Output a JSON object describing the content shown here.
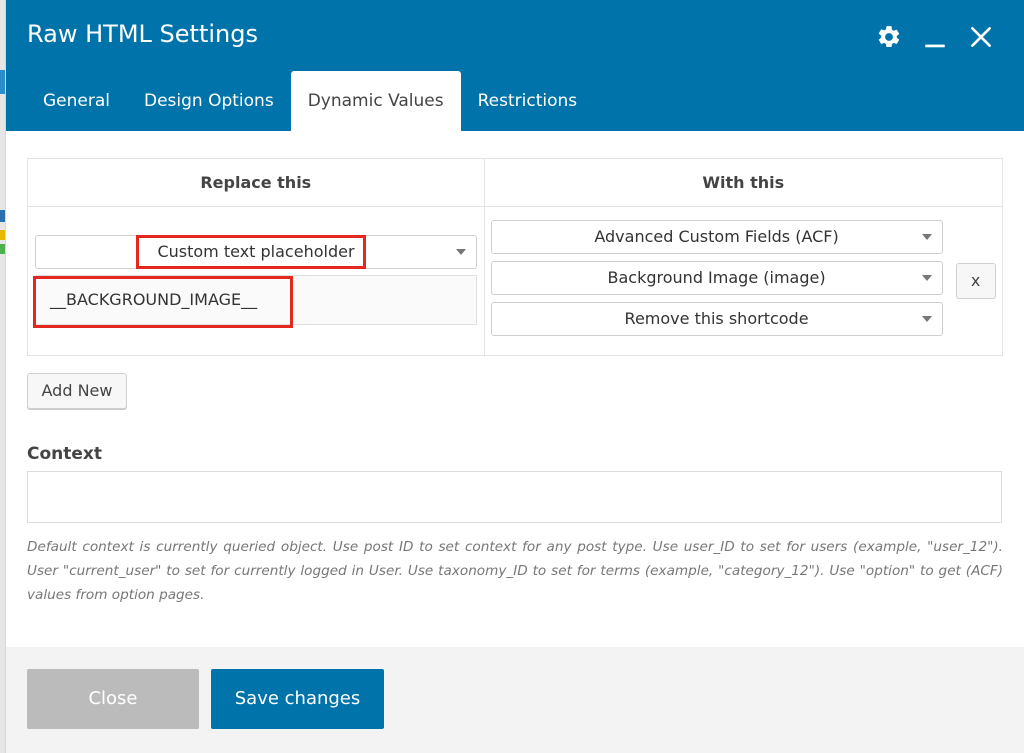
{
  "window": {
    "title": "Raw HTML Settings"
  },
  "header_icons": [
    "gear-icon",
    "minimize-icon",
    "close-icon"
  ],
  "tabs": [
    {
      "label": "General",
      "active": false
    },
    {
      "label": "Design Options",
      "active": false
    },
    {
      "label": "Dynamic Values",
      "active": true
    },
    {
      "label": "Restrictions",
      "active": false
    }
  ],
  "table": {
    "headers": [
      "Replace this",
      "With this"
    ],
    "row": {
      "replace_type": "Custom text placeholder",
      "replace_value": "__BACKGROUND_IMAGE__",
      "source": "Advanced Custom Fields (ACF)",
      "field": "Background Image (image)",
      "fallback": "Remove this shortcode",
      "remove_label": "x"
    }
  },
  "add_new_label": "Add New",
  "context": {
    "label": "Context",
    "value": "",
    "help": "Default context is currently queried object. Use post ID to set context for any post type. Use user_ID to set for users (example, \"user_12\"). User \"current_user\" to set for currently logged in User. Use taxonomy_ID to set for terms (example, \"category_12\"). Use \"option\" to get (ACF) values from option pages."
  },
  "footer": {
    "close_label": "Close",
    "save_label": "Save changes"
  },
  "colors": {
    "header_bg": "#0073aa",
    "highlight": "#e4271f",
    "close_button": "#bbbbbb",
    "save_button": "#0073aa"
  }
}
